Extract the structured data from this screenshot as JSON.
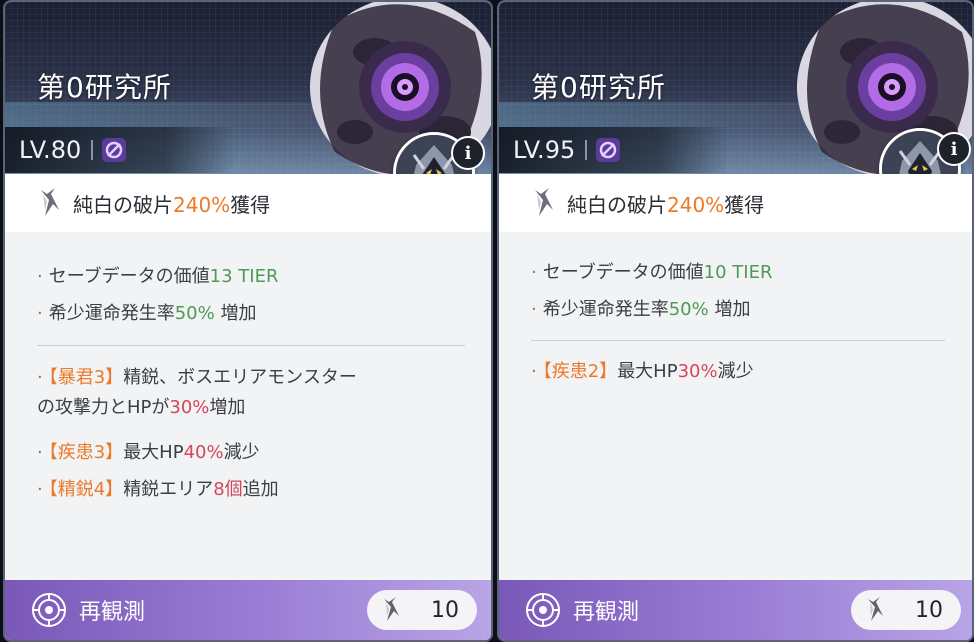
{
  "cards": [
    {
      "title": "第0研究所",
      "level": "LV.80",
      "reward": {
        "prefix": "純白の破片",
        "value": "240%",
        "suffix": "獲得"
      },
      "stats": [
        {
          "text": "セーブデータの価値",
          "value": "13 TIER"
        },
        {
          "text": "希少運命発生率",
          "value": "50%",
          "suffix": " 増加"
        }
      ],
      "effects": [
        {
          "tag": "【暴君3】",
          "text1": "精鋭、ボスエリアモンスター",
          "text2": "の攻撃力とHPが",
          "value": "30%",
          "suffix": "増加"
        },
        {
          "tag": "【疾患3】",
          "text1": "最大HP",
          "value": "40%",
          "suffix": "減少"
        },
        {
          "tag": "【精鋭4】",
          "text1": "精鋭エリア",
          "value": "8個",
          "suffix": "追加"
        }
      ],
      "action_label": "再観測",
      "cost": "10"
    },
    {
      "title": "第0研究所",
      "level": "LV.95",
      "reward": {
        "prefix": "純白の破片",
        "value": "240%",
        "suffix": "獲得"
      },
      "stats": [
        {
          "text": "セーブデータの価値",
          "value": "10 TIER"
        },
        {
          "text": "希少運命発生率",
          "value": "50%",
          "suffix": " 増加"
        }
      ],
      "effects": [
        {
          "tag": "【疾患2】",
          "text1": "最大HP",
          "value": "30%",
          "suffix": "減少"
        }
      ],
      "action_label": "再観測",
      "cost": "10"
    }
  ],
  "bullet": "·",
  "info_glyph": "i",
  "icons": {
    "element": "void-element-icon",
    "shard": "white-shard-icon",
    "reobserve": "radar-target-icon",
    "info": "info-icon"
  },
  "colors": {
    "orange": "#ec7a2a",
    "green": "#4e9a56",
    "red": "#d4475a",
    "footer": "#8e6fcc"
  }
}
